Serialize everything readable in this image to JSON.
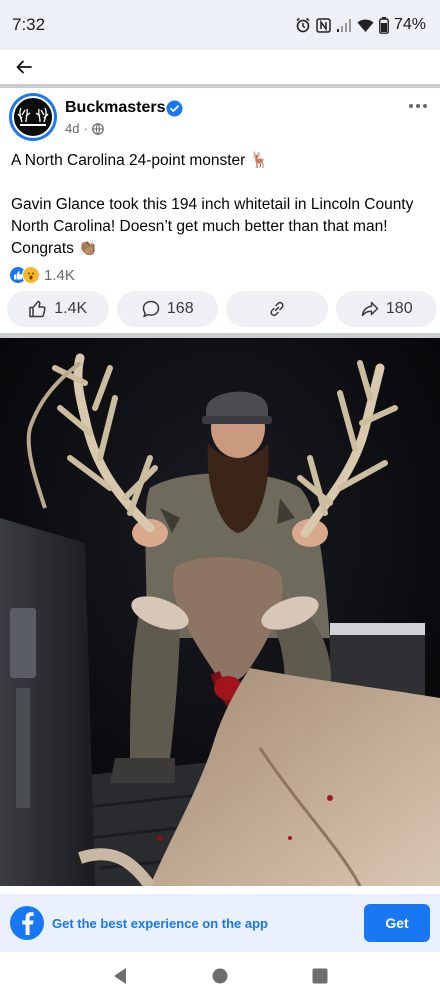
{
  "status_bar": {
    "time": "7:32",
    "battery": "74%",
    "icons": [
      "alarm-icon",
      "nfc-icon",
      "signal-icon",
      "wifi-icon",
      "battery-icon"
    ]
  },
  "nav": {
    "back_icon": "back-arrow-icon"
  },
  "post": {
    "page_name": "Buckmasters",
    "verified": true,
    "age": "4d",
    "privacy_icon": "globe-icon",
    "text_line1": "A North Carolina 24-point monster 🦌",
    "text_body": "Gavin Glance took this 194 inch whitetail in Lincoln County North Carolina! Doesn’t get much better than that man! Congrats 👏🏽",
    "reactions": {
      "types": [
        "like",
        "wow"
      ],
      "count": "1.4K"
    },
    "actions": [
      {
        "icon": "thumbs-up-icon",
        "label": "1.4K"
      },
      {
        "icon": "comment-icon",
        "label": "168"
      },
      {
        "icon": "link-icon",
        "label": ""
      },
      {
        "icon": "share-icon",
        "label": "180"
      }
    ],
    "photo_icon": "photo"
  },
  "app_banner": {
    "text": "Get the best experience on the app",
    "button": "Get"
  },
  "colors": {
    "brand": "#1877f2",
    "status_bg": "#eef0f8",
    "banner_bg": "#eaf1fd",
    "button_bg": "#eef0f3",
    "meta_text": "#65676b"
  }
}
